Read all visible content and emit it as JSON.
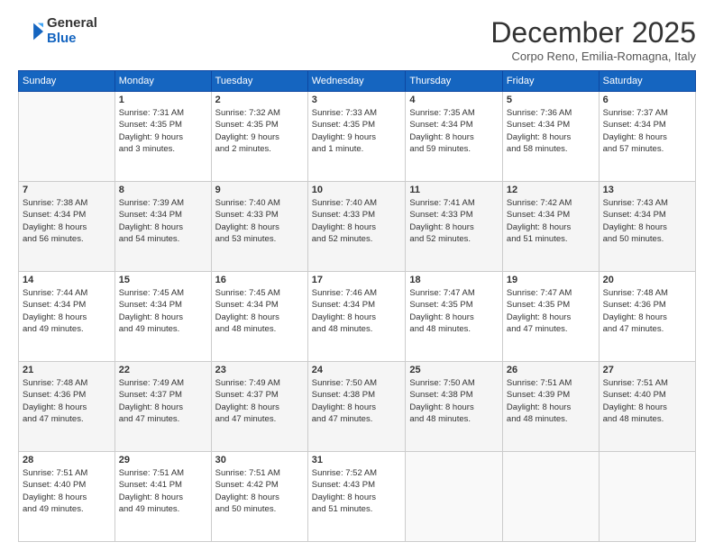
{
  "header": {
    "logo_general": "General",
    "logo_blue": "Blue",
    "month_title": "December 2025",
    "location": "Corpo Reno, Emilia-Romagna, Italy"
  },
  "days_of_week": [
    "Sunday",
    "Monday",
    "Tuesday",
    "Wednesday",
    "Thursday",
    "Friday",
    "Saturday"
  ],
  "weeks": [
    [
      {
        "day": "",
        "info": ""
      },
      {
        "day": "1",
        "info": "Sunrise: 7:31 AM\nSunset: 4:35 PM\nDaylight: 9 hours\nand 3 minutes."
      },
      {
        "day": "2",
        "info": "Sunrise: 7:32 AM\nSunset: 4:35 PM\nDaylight: 9 hours\nand 2 minutes."
      },
      {
        "day": "3",
        "info": "Sunrise: 7:33 AM\nSunset: 4:35 PM\nDaylight: 9 hours\nand 1 minute."
      },
      {
        "day": "4",
        "info": "Sunrise: 7:35 AM\nSunset: 4:34 PM\nDaylight: 8 hours\nand 59 minutes."
      },
      {
        "day": "5",
        "info": "Sunrise: 7:36 AM\nSunset: 4:34 PM\nDaylight: 8 hours\nand 58 minutes."
      },
      {
        "day": "6",
        "info": "Sunrise: 7:37 AM\nSunset: 4:34 PM\nDaylight: 8 hours\nand 57 minutes."
      }
    ],
    [
      {
        "day": "7",
        "info": "Sunrise: 7:38 AM\nSunset: 4:34 PM\nDaylight: 8 hours\nand 56 minutes."
      },
      {
        "day": "8",
        "info": "Sunrise: 7:39 AM\nSunset: 4:34 PM\nDaylight: 8 hours\nand 54 minutes."
      },
      {
        "day": "9",
        "info": "Sunrise: 7:40 AM\nSunset: 4:33 PM\nDaylight: 8 hours\nand 53 minutes."
      },
      {
        "day": "10",
        "info": "Sunrise: 7:40 AM\nSunset: 4:33 PM\nDaylight: 8 hours\nand 52 minutes."
      },
      {
        "day": "11",
        "info": "Sunrise: 7:41 AM\nSunset: 4:33 PM\nDaylight: 8 hours\nand 52 minutes."
      },
      {
        "day": "12",
        "info": "Sunrise: 7:42 AM\nSunset: 4:34 PM\nDaylight: 8 hours\nand 51 minutes."
      },
      {
        "day": "13",
        "info": "Sunrise: 7:43 AM\nSunset: 4:34 PM\nDaylight: 8 hours\nand 50 minutes."
      }
    ],
    [
      {
        "day": "14",
        "info": "Sunrise: 7:44 AM\nSunset: 4:34 PM\nDaylight: 8 hours\nand 49 minutes."
      },
      {
        "day": "15",
        "info": "Sunrise: 7:45 AM\nSunset: 4:34 PM\nDaylight: 8 hours\nand 49 minutes."
      },
      {
        "day": "16",
        "info": "Sunrise: 7:45 AM\nSunset: 4:34 PM\nDaylight: 8 hours\nand 48 minutes."
      },
      {
        "day": "17",
        "info": "Sunrise: 7:46 AM\nSunset: 4:34 PM\nDaylight: 8 hours\nand 48 minutes."
      },
      {
        "day": "18",
        "info": "Sunrise: 7:47 AM\nSunset: 4:35 PM\nDaylight: 8 hours\nand 48 minutes."
      },
      {
        "day": "19",
        "info": "Sunrise: 7:47 AM\nSunset: 4:35 PM\nDaylight: 8 hours\nand 47 minutes."
      },
      {
        "day": "20",
        "info": "Sunrise: 7:48 AM\nSunset: 4:36 PM\nDaylight: 8 hours\nand 47 minutes."
      }
    ],
    [
      {
        "day": "21",
        "info": "Sunrise: 7:48 AM\nSunset: 4:36 PM\nDaylight: 8 hours\nand 47 minutes."
      },
      {
        "day": "22",
        "info": "Sunrise: 7:49 AM\nSunset: 4:37 PM\nDaylight: 8 hours\nand 47 minutes."
      },
      {
        "day": "23",
        "info": "Sunrise: 7:49 AM\nSunset: 4:37 PM\nDaylight: 8 hours\nand 47 minutes."
      },
      {
        "day": "24",
        "info": "Sunrise: 7:50 AM\nSunset: 4:38 PM\nDaylight: 8 hours\nand 47 minutes."
      },
      {
        "day": "25",
        "info": "Sunrise: 7:50 AM\nSunset: 4:38 PM\nDaylight: 8 hours\nand 48 minutes."
      },
      {
        "day": "26",
        "info": "Sunrise: 7:51 AM\nSunset: 4:39 PM\nDaylight: 8 hours\nand 48 minutes."
      },
      {
        "day": "27",
        "info": "Sunrise: 7:51 AM\nSunset: 4:40 PM\nDaylight: 8 hours\nand 48 minutes."
      }
    ],
    [
      {
        "day": "28",
        "info": "Sunrise: 7:51 AM\nSunset: 4:40 PM\nDaylight: 8 hours\nand 49 minutes."
      },
      {
        "day": "29",
        "info": "Sunrise: 7:51 AM\nSunset: 4:41 PM\nDaylight: 8 hours\nand 49 minutes."
      },
      {
        "day": "30",
        "info": "Sunrise: 7:51 AM\nSunset: 4:42 PM\nDaylight: 8 hours\nand 50 minutes."
      },
      {
        "day": "31",
        "info": "Sunrise: 7:52 AM\nSunset: 4:43 PM\nDaylight: 8 hours\nand 51 minutes."
      },
      {
        "day": "",
        "info": ""
      },
      {
        "day": "",
        "info": ""
      },
      {
        "day": "",
        "info": ""
      }
    ]
  ]
}
